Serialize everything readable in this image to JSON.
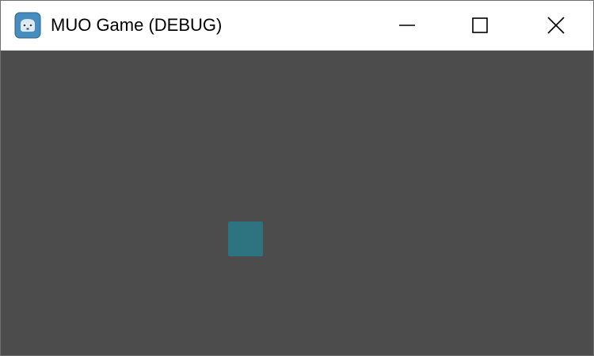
{
  "window": {
    "title": "MUO Game (DEBUG)",
    "icon": "godot-engine-icon"
  },
  "caption_buttons": {
    "minimize": "minimize-icon",
    "maximize": "maximize-icon",
    "close": "close-icon"
  },
  "game": {
    "background_color": "#4c4c4c",
    "sprite": {
      "color": "#2e7380"
    }
  }
}
